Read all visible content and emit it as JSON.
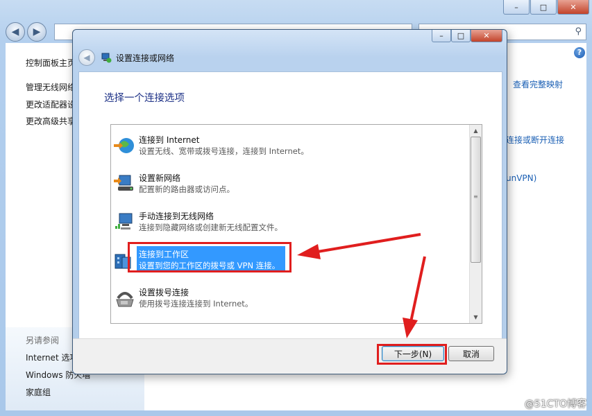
{
  "background": {
    "sidebar": {
      "links": [
        "控制面板主页",
        "管理无线网络",
        "更改适配器设置",
        "更改高级共享设置"
      ],
      "see_also_label": "另请参阅",
      "see_also_links": [
        "Internet 选项",
        "Windows 防火墙",
        "家庭组"
      ]
    },
    "right_links": [
      "查看完整映射",
      "连接或断开连接",
      "unVPN)"
    ]
  },
  "dialog": {
    "title": "设置连接或网络",
    "heading": "选择一个连接选项",
    "options": [
      {
        "title": "连接到 Internet",
        "desc": "设置无线、宽带或拨号连接，连接到 Internet。",
        "icon": "globe-network-icon"
      },
      {
        "title": "设置新网络",
        "desc": "配置新的路由器或访问点。",
        "icon": "router-icon"
      },
      {
        "title": "手动连接到无线网络",
        "desc": "连接到隐藏网络或创建新无线配置文件。",
        "icon": "wireless-computer-icon"
      },
      {
        "title": "连接到工作区",
        "desc": "设置到您的工作区的拨号或 VPN 连接。",
        "icon": "workplace-vpn-icon",
        "selected": true
      },
      {
        "title": "设置拨号连接",
        "desc": "使用拨号连接连接到 Internet。",
        "icon": "telephone-modem-icon"
      }
    ],
    "next_label": "下一步(N)",
    "cancel_label": "取消"
  },
  "watermark": "@51CTO博客",
  "colors": {
    "selection": "#3399ff",
    "annotation": "#e01e1e",
    "heading": "#1e3287"
  }
}
